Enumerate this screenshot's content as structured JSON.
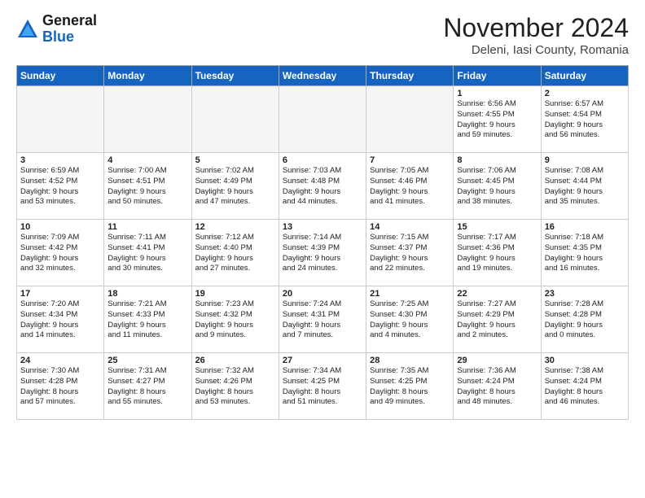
{
  "header": {
    "logo_line1": "General",
    "logo_line2": "Blue",
    "month_year": "November 2024",
    "location": "Deleni, Iasi County, Romania"
  },
  "weekdays": [
    "Sunday",
    "Monday",
    "Tuesday",
    "Wednesday",
    "Thursday",
    "Friday",
    "Saturday"
  ],
  "weeks": [
    [
      {
        "day": "",
        "info": ""
      },
      {
        "day": "",
        "info": ""
      },
      {
        "day": "",
        "info": ""
      },
      {
        "day": "",
        "info": ""
      },
      {
        "day": "",
        "info": ""
      },
      {
        "day": "1",
        "info": "Sunrise: 6:56 AM\nSunset: 4:55 PM\nDaylight: 9 hours\nand 59 minutes."
      },
      {
        "day": "2",
        "info": "Sunrise: 6:57 AM\nSunset: 4:54 PM\nDaylight: 9 hours\nand 56 minutes."
      }
    ],
    [
      {
        "day": "3",
        "info": "Sunrise: 6:59 AM\nSunset: 4:52 PM\nDaylight: 9 hours\nand 53 minutes."
      },
      {
        "day": "4",
        "info": "Sunrise: 7:00 AM\nSunset: 4:51 PM\nDaylight: 9 hours\nand 50 minutes."
      },
      {
        "day": "5",
        "info": "Sunrise: 7:02 AM\nSunset: 4:49 PM\nDaylight: 9 hours\nand 47 minutes."
      },
      {
        "day": "6",
        "info": "Sunrise: 7:03 AM\nSunset: 4:48 PM\nDaylight: 9 hours\nand 44 minutes."
      },
      {
        "day": "7",
        "info": "Sunrise: 7:05 AM\nSunset: 4:46 PM\nDaylight: 9 hours\nand 41 minutes."
      },
      {
        "day": "8",
        "info": "Sunrise: 7:06 AM\nSunset: 4:45 PM\nDaylight: 9 hours\nand 38 minutes."
      },
      {
        "day": "9",
        "info": "Sunrise: 7:08 AM\nSunset: 4:44 PM\nDaylight: 9 hours\nand 35 minutes."
      }
    ],
    [
      {
        "day": "10",
        "info": "Sunrise: 7:09 AM\nSunset: 4:42 PM\nDaylight: 9 hours\nand 32 minutes."
      },
      {
        "day": "11",
        "info": "Sunrise: 7:11 AM\nSunset: 4:41 PM\nDaylight: 9 hours\nand 30 minutes."
      },
      {
        "day": "12",
        "info": "Sunrise: 7:12 AM\nSunset: 4:40 PM\nDaylight: 9 hours\nand 27 minutes."
      },
      {
        "day": "13",
        "info": "Sunrise: 7:14 AM\nSunset: 4:39 PM\nDaylight: 9 hours\nand 24 minutes."
      },
      {
        "day": "14",
        "info": "Sunrise: 7:15 AM\nSunset: 4:37 PM\nDaylight: 9 hours\nand 22 minutes."
      },
      {
        "day": "15",
        "info": "Sunrise: 7:17 AM\nSunset: 4:36 PM\nDaylight: 9 hours\nand 19 minutes."
      },
      {
        "day": "16",
        "info": "Sunrise: 7:18 AM\nSunset: 4:35 PM\nDaylight: 9 hours\nand 16 minutes."
      }
    ],
    [
      {
        "day": "17",
        "info": "Sunrise: 7:20 AM\nSunset: 4:34 PM\nDaylight: 9 hours\nand 14 minutes."
      },
      {
        "day": "18",
        "info": "Sunrise: 7:21 AM\nSunset: 4:33 PM\nDaylight: 9 hours\nand 11 minutes."
      },
      {
        "day": "19",
        "info": "Sunrise: 7:23 AM\nSunset: 4:32 PM\nDaylight: 9 hours\nand 9 minutes."
      },
      {
        "day": "20",
        "info": "Sunrise: 7:24 AM\nSunset: 4:31 PM\nDaylight: 9 hours\nand 7 minutes."
      },
      {
        "day": "21",
        "info": "Sunrise: 7:25 AM\nSunset: 4:30 PM\nDaylight: 9 hours\nand 4 minutes."
      },
      {
        "day": "22",
        "info": "Sunrise: 7:27 AM\nSunset: 4:29 PM\nDaylight: 9 hours\nand 2 minutes."
      },
      {
        "day": "23",
        "info": "Sunrise: 7:28 AM\nSunset: 4:28 PM\nDaylight: 9 hours\nand 0 minutes."
      }
    ],
    [
      {
        "day": "24",
        "info": "Sunrise: 7:30 AM\nSunset: 4:28 PM\nDaylight: 8 hours\nand 57 minutes."
      },
      {
        "day": "25",
        "info": "Sunrise: 7:31 AM\nSunset: 4:27 PM\nDaylight: 8 hours\nand 55 minutes."
      },
      {
        "day": "26",
        "info": "Sunrise: 7:32 AM\nSunset: 4:26 PM\nDaylight: 8 hours\nand 53 minutes."
      },
      {
        "day": "27",
        "info": "Sunrise: 7:34 AM\nSunset: 4:25 PM\nDaylight: 8 hours\nand 51 minutes."
      },
      {
        "day": "28",
        "info": "Sunrise: 7:35 AM\nSunset: 4:25 PM\nDaylight: 8 hours\nand 49 minutes."
      },
      {
        "day": "29",
        "info": "Sunrise: 7:36 AM\nSunset: 4:24 PM\nDaylight: 8 hours\nand 48 minutes."
      },
      {
        "day": "30",
        "info": "Sunrise: 7:38 AM\nSunset: 4:24 PM\nDaylight: 8 hours\nand 46 minutes."
      }
    ]
  ]
}
